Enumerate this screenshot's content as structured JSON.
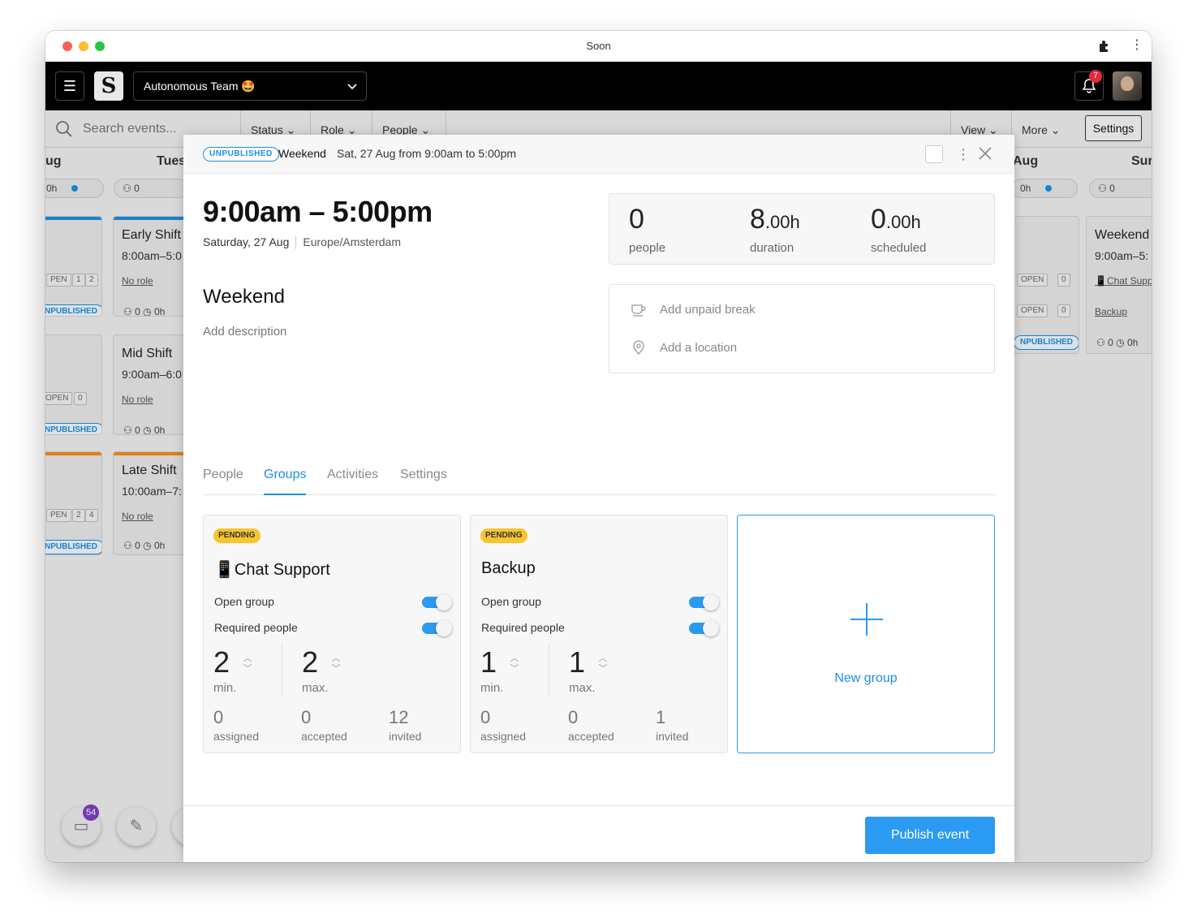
{
  "window": {
    "title": "Soon"
  },
  "appbar": {
    "team_name": "Autonomous Team 🤩",
    "notification_count": "7"
  },
  "filters": {
    "search_placeholder": "Search events...",
    "status": "Status",
    "role": "Role",
    "people": "People",
    "view": "View",
    "more": "More",
    "settings": "Settings"
  },
  "calendar": {
    "col1_head": "ug",
    "col2_head": "Tues",
    "col3_head": "Aug",
    "col4_head": "Sur",
    "col1_pill": "0h",
    "col2_pill": "0",
    "col3_pill": "0h",
    "col4_pill": "0",
    "cards": {
      "early": {
        "title": "Early Shift",
        "time": "8:00am–5:0",
        "role": "No role"
      },
      "mid": {
        "title": "Mid Shift",
        "time": "9:00am–6:0",
        "role": "No role"
      },
      "late": {
        "title": "Late Shift",
        "time": "10:00am–7:",
        "role": "No role"
      },
      "weekend": {
        "title": "Weekend",
        "time": "9:00am–5:",
        "role1": "📱Chat Supp",
        "role2": "Backup"
      }
    },
    "stat_text": "0",
    "stat_hours": "0h",
    "badge_open": "OPEN",
    "badge_pen": "PEN",
    "badge_unpub": "NPUBLISHED",
    "badge_unpub_full": "UNPUBLISHED",
    "n1": "1",
    "n2": "2",
    "n0": "0",
    "n4": "4"
  },
  "fab": {
    "inbox_count": "54"
  },
  "modal": {
    "status_badge": "UNPUBLISHED",
    "title": "Weekend",
    "subtitle": "Sat, 27 Aug from 9:00am to 5:00pm",
    "time_range": "9:00am – 5:00pm",
    "date": "Saturday, 27 Aug",
    "timezone": "Europe/Amsterdam",
    "stats": {
      "people_value": "0",
      "people_label": "people",
      "duration_int": "8",
      "duration_frac": ".00h",
      "duration_label": "duration",
      "scheduled_int": "0",
      "scheduled_frac": ".00h",
      "scheduled_label": "scheduled"
    },
    "add_break": "Add unpaid break",
    "add_location": "Add a location",
    "event_name": "Weekend",
    "add_description": "Add description",
    "tabs": [
      "People",
      "Groups",
      "Activities",
      "Settings"
    ],
    "groups": [
      {
        "status": "PENDING",
        "name": "📱Chat Support",
        "open_group_label": "Open group",
        "required_people_label": "Required people",
        "min": "2",
        "min_label": "min.",
        "max": "2",
        "max_label": "max.",
        "assigned": "0",
        "assigned_label": "assigned",
        "accepted": "0",
        "accepted_label": "accepted",
        "invited": "12",
        "invited_label": "invited"
      },
      {
        "status": "PENDING",
        "name": "Backup",
        "open_group_label": "Open group",
        "required_people_label": "Required people",
        "min": "1",
        "min_label": "min.",
        "max": "1",
        "max_label": "max.",
        "assigned": "0",
        "assigned_label": "assigned",
        "accepted": "0",
        "accepted_label": "accepted",
        "invited": "1",
        "invited_label": "invited"
      }
    ],
    "new_group_label": "New group",
    "publish_label": "Publish event"
  },
  "colors": {
    "accent": "#2b9af3",
    "pending": "#f7c52c",
    "badge_red": "#e5283b",
    "badge_purple": "#7b3fbf",
    "shift_blue": "#1a8fe0",
    "shift_orange": "#f08c1c"
  }
}
